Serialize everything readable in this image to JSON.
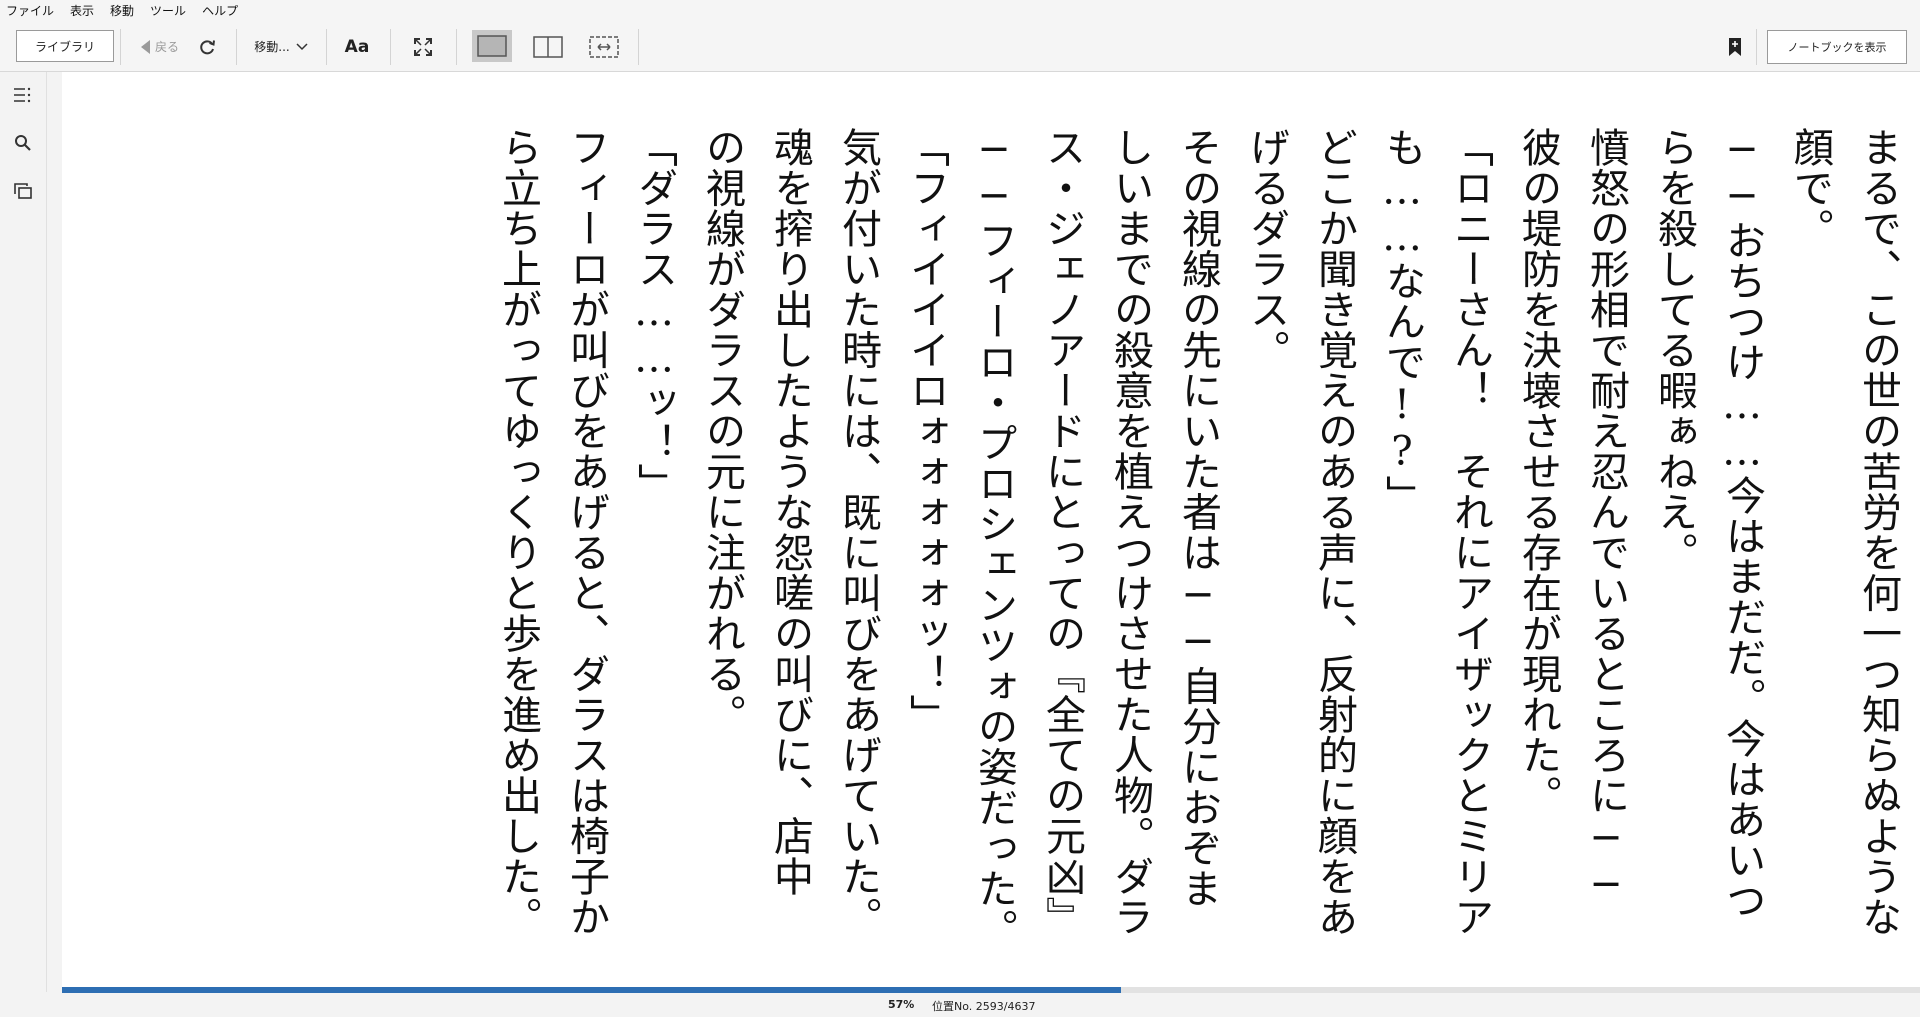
{
  "menu": [
    "ファイル",
    "表示",
    "移動",
    "ツール",
    "ヘルプ"
  ],
  "toolbar": {
    "library_label": "ライブラリ",
    "back_label": "戻る",
    "goto_label": "移動...",
    "font_label": "Aa",
    "notebook_label": "ノートブックを表示"
  },
  "text_lines": [
    "まるで、この世の苦労を何一つ知らぬような",
    "顔で。",
    "──おちつけ……今はまだだ。今はあいつ",
    "らを殺してる暇ぁねえ。",
    "憤怒の形相で耐え忍んでいるところに──",
    "彼の堤防を決壊させる存在が現れた。",
    "「ロニーさん！　それにアイザックとミリア",
    "も……なんで!?」",
    "どこか聞き覚えのある声に、反射的に顔をあ",
    "げるダラス。",
    "その視線の先にいた者は──自分におぞま",
    "しいまでの殺意を植えつけさせた人物。ダラ",
    "ス・ジェノアードにとっての『全ての元凶』",
    "──フィーロ・プロシェンツォの姿だった。",
    "「フィイイイロォォォォォッ！」",
    "気が付いた時には、既に叫びをあげていた。",
    "魂を搾り出したような怨嗟の叫びに、店中",
    "の視線がダラスの元に注がれる。",
    "「ダラス……ッ！」",
    "フィーロが叫びをあげると、ダラスは椅子か",
    "ら立ち上がってゆっくりと歩を進め出した。"
  ],
  "status": {
    "percent_label": "57%",
    "location_label": "位置No. 2593/4637",
    "progress_fraction": 0.57
  },
  "colors": {
    "accent": "#2d6eb3",
    "page_bg": "#ffffff",
    "chrome_bg": "#f5f5f5"
  },
  "icons": {
    "toc": "list-icon",
    "search": "search-icon",
    "flashcards": "cards-icon",
    "sync": "refresh-icon",
    "fullscreen": "expand-icon",
    "bookmark": "bookmark-icon"
  }
}
